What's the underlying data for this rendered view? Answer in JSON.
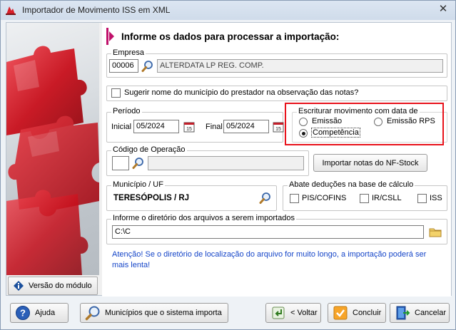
{
  "window": {
    "title": "Importador de Movimento ISS em XML"
  },
  "header": {
    "title": "Informe os dados para processar a importação:"
  },
  "empresa": {
    "legend": "Empresa",
    "code": "00006",
    "name": "ALTERDATA LP REG. COMP."
  },
  "sugerir": {
    "label": "Sugerir nome do município do prestador na observação das notas?",
    "checked": false
  },
  "periodo": {
    "legend": "Período",
    "inicial_label": "Inicial",
    "inicial_value": "05/2024",
    "final_label": "Final",
    "final_value": "05/2024"
  },
  "escriturar": {
    "legend": "Escriturar movimento com data de",
    "options": [
      {
        "label": "Emissão",
        "selected": false
      },
      {
        "label": "Emissão RPS",
        "selected": false
      },
      {
        "label": "Competência",
        "selected": true
      }
    ]
  },
  "codigo": {
    "legend": "Código de Operação",
    "value": "",
    "description": ""
  },
  "importar_button": "Importar notas do NF-Stock",
  "municipio": {
    "legend": "Município / UF",
    "value": "TERESÓPOLIS / RJ"
  },
  "abate": {
    "legend": "Abate deduções na base de cálculo",
    "options": [
      {
        "label": "PIS/COFINS",
        "checked": false
      },
      {
        "label": "IR/CSLL",
        "checked": false
      },
      {
        "label": "ISS",
        "checked": false
      }
    ]
  },
  "diretorio": {
    "legend": "Informe o diretório dos arquivos a serem importados",
    "value": "C:\\C"
  },
  "warning": "Atenção! Se o diretório de localização do arquivo for muito longo, a importação poderá ser mais lenta!",
  "versao_button": "Versão do módulo",
  "footer": {
    "ajuda": "Ajuda",
    "municipios": "Municípios que o sistema importa",
    "voltar": "< Voltar",
    "concluir": "Concluir",
    "cancelar": "Cancelar"
  },
  "colors": {
    "accent": "#e8121b",
    "warning_text": "#1545c8",
    "header_arrow": "#c0106a"
  }
}
